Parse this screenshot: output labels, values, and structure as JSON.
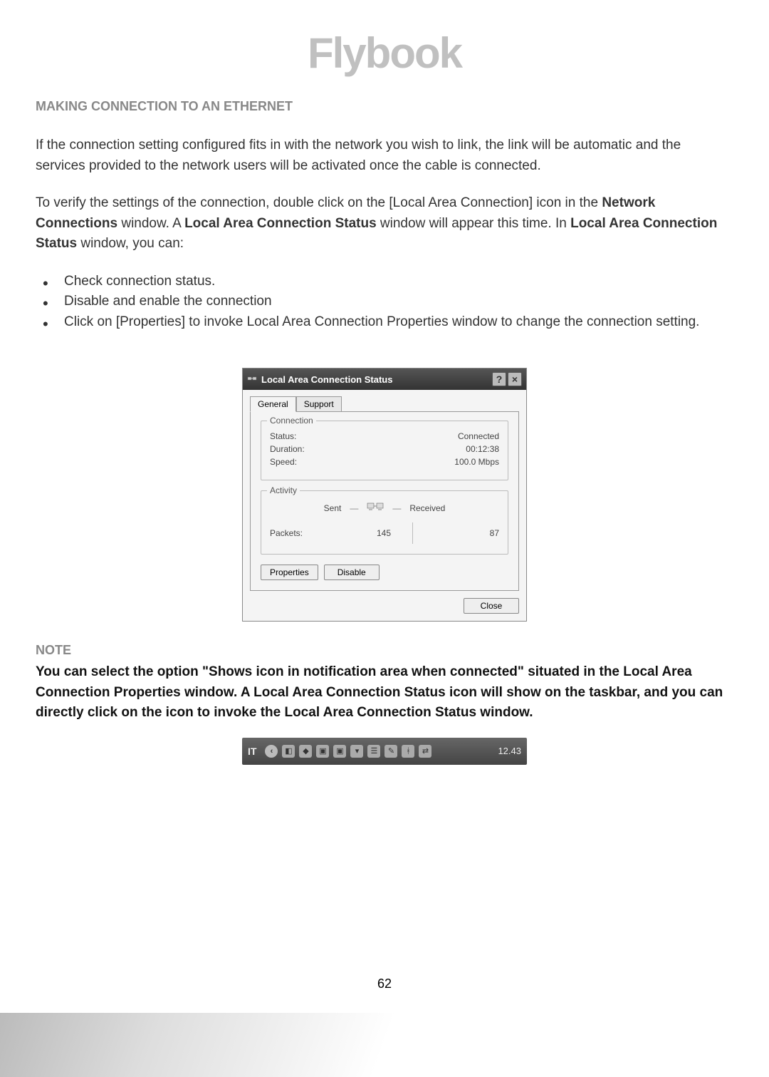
{
  "logo": "Flybook",
  "section_title": "MAKING CONNECTION TO AN ETHERNET",
  "para1": "If the connection setting configured fits in with the network you wish to link, the link will be automatic and the services provided to the network users will be activated once the cable is connected.",
  "para2_pre": "To verify the settings of the connection, double click on the [Local Area Connection] icon in the ",
  "para2_bold1": "Network Connections",
  "para2_mid": " window. A ",
  "para2_bold2": "Local Area Connection Status",
  "para2_mid2": " window will appear this time. In ",
  "para2_bold3": "Local Area Connection Status",
  "para2_post": " window, you can:",
  "bullets": [
    "Check connection status.",
    "Disable and enable the connection",
    "Click on [Properties] to invoke Local Area Connection Properties window to change the connection setting."
  ],
  "dialog": {
    "title": "Local Area Connection Status",
    "tabs": {
      "general": "General",
      "support": "Support"
    },
    "connection": {
      "legend": "Connection",
      "status_label": "Status:",
      "status_value": "Connected",
      "duration_label": "Duration:",
      "duration_value": "00:12:38",
      "speed_label": "Speed:",
      "speed_value": "100.0 Mbps"
    },
    "activity": {
      "legend": "Activity",
      "sent_label": "Sent",
      "received_label": "Received",
      "packets_label": "Packets:",
      "sent_value": "145",
      "received_value": "87"
    },
    "buttons": {
      "properties": "Properties",
      "disable": "Disable",
      "close": "Close"
    }
  },
  "note_label": "NOTE",
  "note_text": "You can select the option \"Shows icon in notification area when connected\" situated in the Local Area Connection Properties window. A Local Area Connection Status icon will show on the taskbar, and you can directly click on the icon to invoke the Local Area Connection Status window.",
  "taskbar": {
    "lang": "IT",
    "time": "12.43"
  },
  "page_number": "62"
}
